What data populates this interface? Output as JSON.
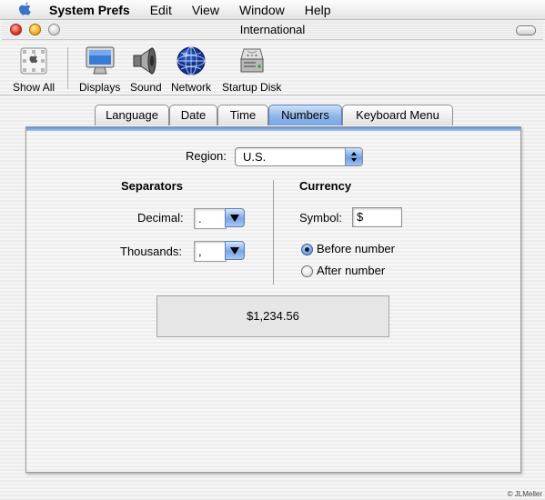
{
  "menubar": {
    "apple_icon": "apple-logo-icon",
    "items": [
      "System Prefs",
      "Edit",
      "View",
      "Window",
      "Help"
    ]
  },
  "window": {
    "title": "International"
  },
  "toolbar": {
    "items": [
      {
        "label": "Show All",
        "icon": "show-all-icon"
      },
      {
        "label": "Displays",
        "icon": "display-monitor-icon"
      },
      {
        "label": "Sound",
        "icon": "speaker-icon"
      },
      {
        "label": "Network",
        "icon": "globe-icon"
      },
      {
        "label": "Startup Disk",
        "icon": "hard-disk-icon"
      }
    ]
  },
  "tabs": {
    "items": [
      "Language",
      "Date",
      "Time",
      "Numbers",
      "Keyboard Menu"
    ],
    "selected": "Numbers"
  },
  "numbers": {
    "region_label": "Region:",
    "region_value": "U.S.",
    "separators": {
      "heading": "Separators",
      "decimal_label": "Decimal:",
      "decimal_value": ".",
      "thousands_label": "Thousands:",
      "thousands_value": ","
    },
    "currency": {
      "heading": "Currency",
      "symbol_label": "Symbol:",
      "symbol_value": "$",
      "before_label": "Before number",
      "after_label": "After number",
      "selected": "Before number"
    },
    "sample": "$1,234.56"
  },
  "credit": "© JLMeller",
  "colors": {
    "tab_selected": "#8fb6e9",
    "popup_arrow": "#6f9fe0",
    "close_light": "#e2351f",
    "minimize_light": "#f2b01a"
  }
}
